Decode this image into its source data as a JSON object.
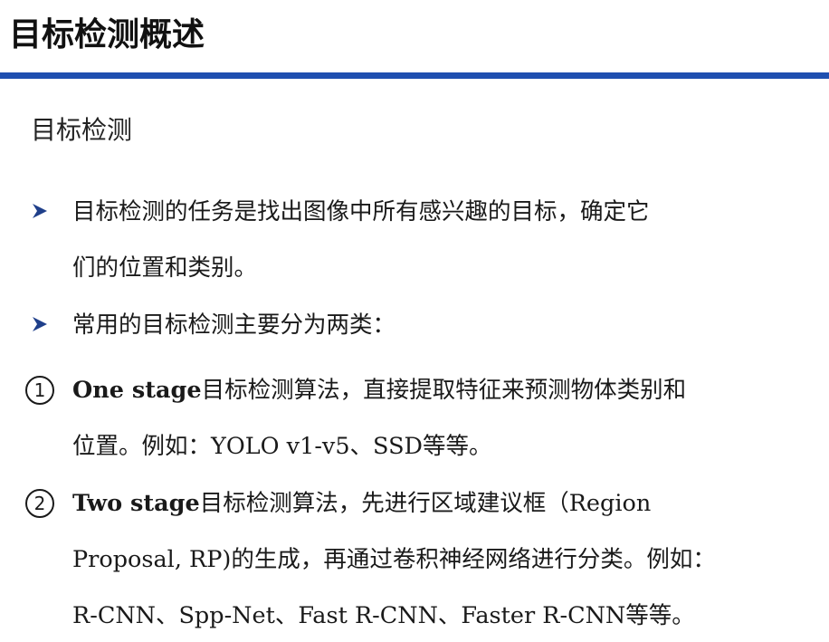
{
  "slide": {
    "title": "目标检测概述",
    "accent_color": "#1f4fb0"
  },
  "subtitle": "目标检测",
  "bullets": [
    {
      "marker_icon": "right-arrowhead-icon",
      "lines": [
        "目标检测的任务是找出图像中所有感兴趣的目标，确定它",
        "们的位置和类别。"
      ]
    },
    {
      "marker_icon": "right-arrowhead-icon",
      "lines": [
        "常用的目标检测主要分为两类："
      ]
    }
  ],
  "numbered": [
    {
      "number": "1",
      "term": "One stage",
      "line1_rest": "目标检测算法，直接提取特征来预测物体类别和",
      "lines_more": [
        "位置。例如：YOLO v1-v5、SSD等等。"
      ]
    },
    {
      "number": "2",
      "term": "Two stage",
      "line1_rest": "目标检测算法，先进行区域建议框（Region",
      "lines_more": [
        "Proposal, RP)的生成，再通过卷积神经网络进行分类。例如：",
        "R-CNN、Spp-Net、Fast R-CNN、Faster R-CNN等等。"
      ]
    }
  ]
}
